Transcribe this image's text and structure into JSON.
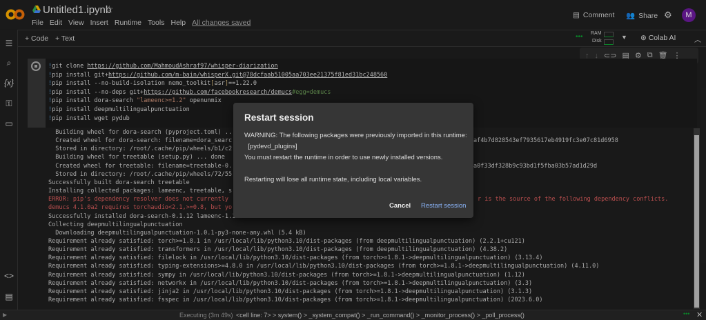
{
  "header": {
    "title": "Untitled1.ipynb",
    "menu": [
      "File",
      "Edit",
      "View",
      "Insert",
      "Runtime",
      "Tools",
      "Help"
    ],
    "saved": "All changes saved",
    "comment": "Comment",
    "share": "Share",
    "avatar": "M"
  },
  "toolbar": {
    "code": "+ Code",
    "text": "+ Text",
    "ram": "RAM",
    "disk": "Disk",
    "colab_ai": "Colab AI"
  },
  "cell": {
    "lines": [
      [
        [
          "bang",
          "!"
        ],
        [
          "",
          "git clone "
        ],
        [
          "url",
          "https://github.com/MahmoudAshraf97/whisper-diarization"
        ]
      ],
      [
        [
          "bang",
          "!"
        ],
        [
          "",
          "pip install git+"
        ],
        [
          "url",
          "https://github.com/m-bain/whisperX.git@78dcfaab51005aa703ee21375f81ed31bc248560"
        ]
      ],
      [
        [
          "bang",
          "!"
        ],
        [
          "",
          "pip install --no-build-isolation nemo_toolkit"
        ],
        [
          "brk",
          "["
        ],
        [
          "",
          "asr"
        ],
        [
          "brk",
          "]"
        ],
        [
          "",
          "==1.22.0"
        ]
      ],
      [
        [
          "bang",
          "!"
        ],
        [
          "",
          "pip install --no-deps git+"
        ],
        [
          "url",
          "https://github.com/facebookresearch/demucs"
        ],
        [
          "cmt",
          "#egg=demucs"
        ]
      ],
      [
        [
          "bang",
          "!"
        ],
        [
          "",
          "pip install dora-search "
        ],
        [
          "str",
          "\"lameenc>=1.2\""
        ],
        [
          "",
          " openunmix"
        ]
      ],
      [
        [
          "bang",
          "!"
        ],
        [
          "",
          "pip install deepmultilingualpunctuation"
        ]
      ],
      [
        [
          "bang",
          "!"
        ],
        [
          "",
          "pip install wget pydub"
        ]
      ]
    ]
  },
  "output": {
    "lines": [
      {
        "t": "  Building wheel for dora-search (pyproject.toml) ..."
      },
      {
        "t": "  Created wheel for dora-search: filename=dora_searc",
        "r": "af4b7d828543ef7935617eb4919fc3e07c81d6958"
      },
      {
        "t": "  Stored in directory: /root/.cache/pip/wheels/b1/c2"
      },
      {
        "t": "  Building wheel for treetable (setup.py) ... done"
      },
      {
        "t": "  Created wheel for treetable: filename=treetable-0.",
        "r": "a0f33df328b9c93bd1f5fba03b57ad1d29d"
      },
      {
        "t": "  Stored in directory: /root/.cache/pip/wheels/72/55"
      },
      {
        "t": "Successfully built dora-search treetable"
      },
      {
        "t": "Installing collected packages: lameenc, treetable, s"
      },
      {
        "t": "ERROR: pip's dependency resolver does not currently",
        "r": "r is the source of the following dependency conflicts.",
        "err": true
      },
      {
        "t": "demucs 4.1.0a2 requires torchaudio<2.1,>=0.8, but yo",
        "err": true
      },
      {
        "t": "Successfully installed dora-search-0.1.12 lameenc-1.1"
      },
      {
        "t": "Collecting deepmultilingualpunctuation"
      },
      {
        "t": "  Downloading deepmultilingualpunctuation-1.0.1-py3-none-any.whl (5.4 kB)"
      },
      {
        "t": "Requirement already satisfied: torch>=1.8.1 in /usr/local/lib/python3.10/dist-packages (from deepmultilingualpunctuation) (2.2.1+cu121)"
      },
      {
        "t": "Requirement already satisfied: transformers in /usr/local/lib/python3.10/dist-packages (from deepmultilingualpunctuation) (4.38.2)"
      },
      {
        "t": "Requirement already satisfied: filelock in /usr/local/lib/python3.10/dist-packages (from torch>=1.8.1->deepmultilingualpunctuation) (3.13.4)"
      },
      {
        "t": "Requirement already satisfied: typing-extensions>=4.8.0 in /usr/local/lib/python3.10/dist-packages (from torch>=1.8.1->deepmultilingualpunctuation) (4.11.0)"
      },
      {
        "t": "Requirement already satisfied: sympy in /usr/local/lib/python3.10/dist-packages (from torch>=1.8.1->deepmultilingualpunctuation) (1.12)"
      },
      {
        "t": "Requirement already satisfied: networkx in /usr/local/lib/python3.10/dist-packages (from torch>=1.8.1->deepmultilingualpunctuation) (3.3)"
      },
      {
        "t": "Requirement already satisfied: jinja2 in /usr/local/lib/python3.10/dist-packages (from torch>=1.8.1->deepmultilingualpunctuation) (3.1.3)"
      },
      {
        "t": "Requirement already satisfied: fsspec in /usr/local/lib/python3.10/dist-packages (from torch>=1.8.1->deepmultilingualpunctuation) (2023.6.0)"
      }
    ]
  },
  "dialog": {
    "title": "Restart session",
    "warning": "WARNING: The following packages were previously imported in this runtime:",
    "packages": "  [pydevd_plugins]",
    "must": "You must restart the runtime in order to use newly installed versions.",
    "lose": "Restarting will lose all runtime state, including local variables.",
    "cancel": "Cancel",
    "restart": "Restart session"
  },
  "status": {
    "executing": "Executing (3m 49s)",
    "trace": "<cell line: 7> > system() > _system_compat() > _run_command() > _monitor_process() > _poll_process()"
  },
  "colors": {
    "accent": "#8ab4f8",
    "error": "#d95c5c",
    "avatar": "#6a1b9a"
  }
}
